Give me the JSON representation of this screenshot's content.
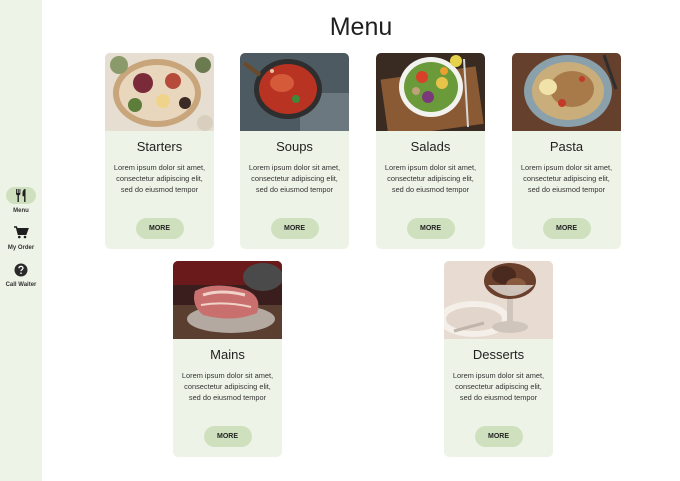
{
  "sidebar": {
    "items": [
      {
        "label": "Menu",
        "icon": "utensils-icon",
        "active": true
      },
      {
        "label": "My Order",
        "icon": "cart-icon",
        "active": false
      },
      {
        "label": "Call Waiter",
        "icon": "help-icon",
        "active": false
      }
    ]
  },
  "page": {
    "title": "Menu"
  },
  "cards": [
    {
      "title": "Starters",
      "description": "Lorem ipsum dolor sit amet, consectetur adipiscing elit, sed do eiusmod tempor",
      "button": "MORE"
    },
    {
      "title": "Soups",
      "description": "Lorem ipsum dolor sit amet, consectetur adipiscing elit, sed do eiusmod tempor",
      "button": "MORE"
    },
    {
      "title": "Salads",
      "description": "Lorem ipsum dolor sit amet, consectetur adipiscing elit, sed do eiusmod tempor",
      "button": "MORE"
    },
    {
      "title": "Pasta",
      "description": "Lorem ipsum dolor sit amet, consectetur adipiscing elit, sed do eiusmod tempor",
      "button": "MORE"
    },
    {
      "title": "Mains",
      "description": "Lorem ipsum dolor sit amet, consectetur adipiscing elit, sed do eiusmod tempor",
      "button": "MORE"
    },
    {
      "title": "Desserts",
      "description": "Lorem ipsum dolor sit amet, consectetur adipiscing elit, sed do eiusmod tempor",
      "button": "MORE"
    }
  ],
  "colors": {
    "sidebar_bg": "#eef3e7",
    "card_bg": "#eef3e7",
    "accent": "#cfe0bf"
  }
}
